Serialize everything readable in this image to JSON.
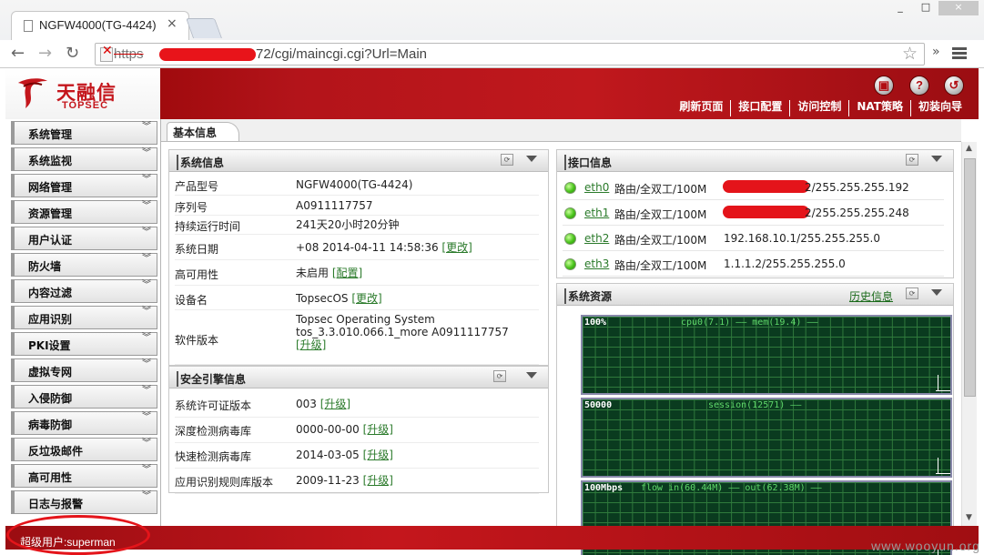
{
  "browser": {
    "tab_title": "NGFW4000(TG-4424)",
    "tab_close": "×",
    "window_controls": [
      "_",
      "□",
      "×"
    ],
    "url_scheme": "https",
    "url_sep": "://",
    "url_path": "72/cgi/maincgi.cgi?Url=Main",
    "ext_label": "»",
    "nav_back": "←",
    "nav_forward": "→",
    "nav_reload": "↻"
  },
  "header": {
    "logo_cn": "天融信",
    "logo_en": "TOPSEC",
    "icons": [
      "save-icon",
      "help-icon",
      "logout-icon"
    ],
    "icon_glyphs": [
      "▣",
      "?",
      "↺"
    ],
    "nav": [
      "刷新页面",
      "接口配置",
      "访问控制",
      "NAT策略",
      "初装向导"
    ]
  },
  "sidebar": {
    "items": [
      "系统管理",
      "系统监视",
      "网络管理",
      "资源管理",
      "用户认证",
      "防火墙",
      "内容过滤",
      "应用识别",
      "PKI设置",
      "虚拟专网",
      "入侵防御",
      "病毒防御",
      "反垃圾邮件",
      "高可用性",
      "日志与报警"
    ],
    "chevron": "︾"
  },
  "main": {
    "tab": "基本信息"
  },
  "system_info": {
    "title": "系统信息",
    "rows": [
      {
        "k": "产品型号",
        "v": "NGFW4000(TG-4424)",
        "link": ""
      },
      {
        "k": "序列号",
        "v": "A0911117757",
        "link": ""
      },
      {
        "k": "持续运行时间",
        "v": "241天20小时20分钟",
        "link": ""
      },
      {
        "k": "系统日期",
        "v": "+08 2014-04-11 14:58:36",
        "link": "[更改]"
      },
      {
        "k": "高可用性",
        "v": "未启用",
        "link": "[配置]"
      },
      {
        "k": "设备名",
        "v": "TopsecOS",
        "link": "[更改]"
      },
      {
        "k": "软件版本",
        "v": "Topsec Operating System",
        "v2": "tos_3.3.010.066.1_more A0911117757",
        "link": "[升级]"
      }
    ]
  },
  "engine_info": {
    "title": "安全引擎信息",
    "rows": [
      {
        "k": "系统许可证版本",
        "v": "003",
        "link": "[升级]"
      },
      {
        "k": "深度检测病毒库",
        "v": "0000-00-00",
        "link": "[升级]"
      },
      {
        "k": "快速检测病毒库",
        "v": "2014-03-05",
        "link": "[升级]"
      },
      {
        "k": "应用识别规则库版本",
        "v": "2009-11-23",
        "link": "[升级]"
      }
    ]
  },
  "interfaces": {
    "title": "接口信息",
    "rows": [
      {
        "name": "eth0",
        "mode": "路由/全双工/100M",
        "addr": "2/255.255.255.192",
        "redacted": true
      },
      {
        "name": "eth1",
        "mode": "路由/全双工/100M",
        "addr": "2/255.255.255.248",
        "redacted": true
      },
      {
        "name": "eth2",
        "mode": "路由/全双工/100M",
        "addr": "192.168.10.1/255.255.255.0",
        "redacted": false
      },
      {
        "name": "eth3",
        "mode": "路由/全双工/100M",
        "addr": "1.1.1.2/255.255.255.0",
        "redacted": false
      }
    ]
  },
  "resources": {
    "title": "系统资源",
    "history_link": "历史信息",
    "graphs": [
      {
        "scale": "100%",
        "legend": "cpu0(7.1) ——  mem(19.4) ——"
      },
      {
        "scale": "50000",
        "legend": "session(12571) ——"
      },
      {
        "scale": "100Mbps",
        "legend": "flow in(60.44M) ——        out(62.38M) ——"
      }
    ]
  },
  "footer": {
    "user": "超级用户:superman",
    "watermark": "www.wooyun.org"
  },
  "colors": {
    "brand_red": "#c4161c",
    "link_green": "#2a7a2a",
    "status_green": "#48c31a",
    "graph_bg": "#0a3b1f"
  }
}
